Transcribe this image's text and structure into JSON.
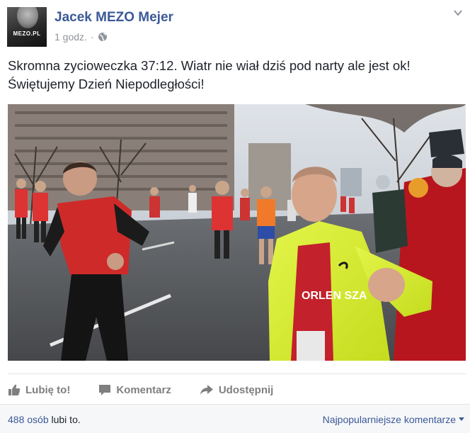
{
  "post": {
    "author": "Jacek MEZO Mejer",
    "avatar_tag": "MEZO.PL",
    "time": "1 godz.",
    "separator": "·",
    "text_line1": "Skromna zycioweczka 37:12. Wiatr nie wiał dziś pod narty ale jest ok!",
    "text_line2": "Świętujemy Dzień Niepodległości!",
    "photo_bib_text": "ORLEN SZA"
  },
  "actions": {
    "like": "Lubię to!",
    "comment": "Komentarz",
    "share": "Udostępnij"
  },
  "footer": {
    "likes_count": "488 osób",
    "likes_suffix": "lubi to.",
    "sort_label": "Najpopularniejsze komentarze"
  },
  "icons": {
    "privacy": "globe-icon",
    "menu": "chevron-down-icon",
    "like": "thumbs-up-icon",
    "comment": "comment-icon",
    "share": "share-arrow-icon"
  },
  "colors": {
    "link": "#3b5998",
    "muted": "#90949c",
    "action": "#7f7f7f"
  }
}
